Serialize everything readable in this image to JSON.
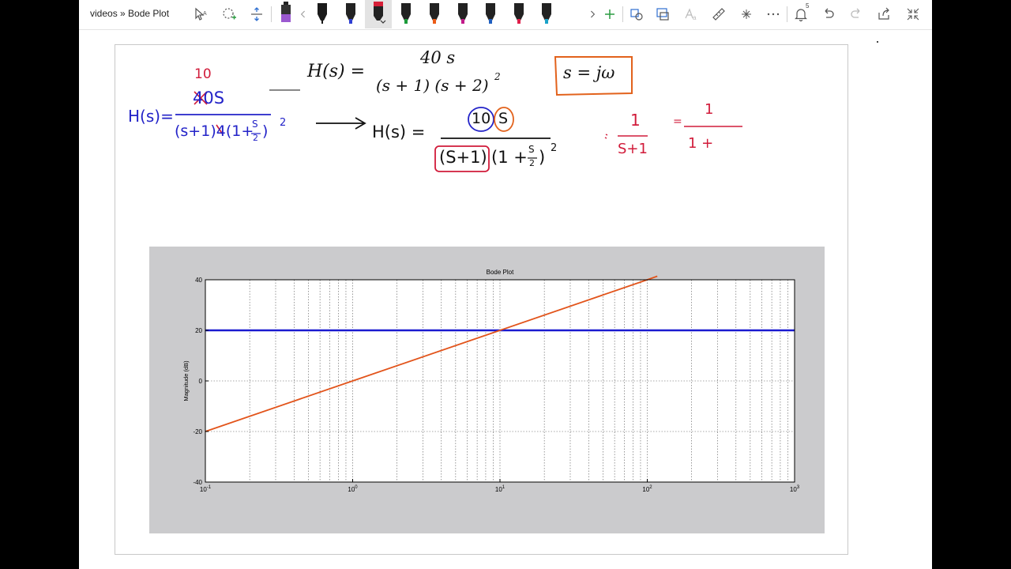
{
  "breadcrumb": "videos » Bode Plot",
  "toolbar": {
    "notification_count": "5",
    "pens": [
      {
        "color": "#9b59d0"
      },
      {
        "color": "#1a1a1a"
      },
      {
        "color": "#2f3fd3"
      },
      {
        "color": "#d61f38"
      },
      {
        "color": "#1b9b3a"
      },
      {
        "color": "#ec5b16"
      },
      {
        "color": "#c21b8a"
      },
      {
        "color": "#1f5fc0"
      },
      {
        "color": "#e01f4a"
      },
      {
        "color": "#1aa2c8"
      }
    ]
  },
  "equations": {
    "typed_lhs": "H(s) =",
    "typed_num": "40 s",
    "typed_den": "(s + 1) (s + 2)",
    "typed_den_exp": "2",
    "boxed": "s = jω",
    "hw_lhs": "H(s)=",
    "hw_num_fix": "10",
    "hw_num": "40S",
    "hw_den": "(s+1)4(1+",
    "hw_den_tail": ")",
    "hw_exp": "2",
    "hw2_lhs": "H(s) =",
    "hw2_num_a": "10",
    "hw2_num_b": "S",
    "hw2_den_a": "(S+1)",
    "hw2_den_b": "(1 +",
    "hw2_den_c": ")",
    "hw2_exp": "2",
    "frac_s": "S",
    "frac_2": "2",
    "side_num1": "1",
    "side_den1": "S+1",
    "side_eq": "=",
    "side_num2": "1",
    "side_den2": "1 +"
  },
  "chart_data": {
    "type": "line",
    "title": "Bode Plot",
    "xlabel": "",
    "ylabel": "Magnitude (dB)",
    "xscale": "log",
    "xlim": [
      0.1,
      1000
    ],
    "ylim": [
      -40,
      40
    ],
    "xticks": [
      "10-1",
      "100",
      "101",
      "102",
      "103"
    ],
    "yticks": [
      "40",
      "20",
      "0",
      "-20",
      "-40"
    ],
    "grid": true,
    "series": [
      {
        "color": "#1a1ad0",
        "x": [
          0.1,
          1000
        ],
        "y": [
          20,
          20
        ]
      },
      {
        "color": "#e2541b",
        "x": [
          0.1,
          1,
          10,
          100,
          117
        ],
        "y": [
          -20,
          0,
          20,
          40,
          41.4
        ]
      }
    ]
  }
}
